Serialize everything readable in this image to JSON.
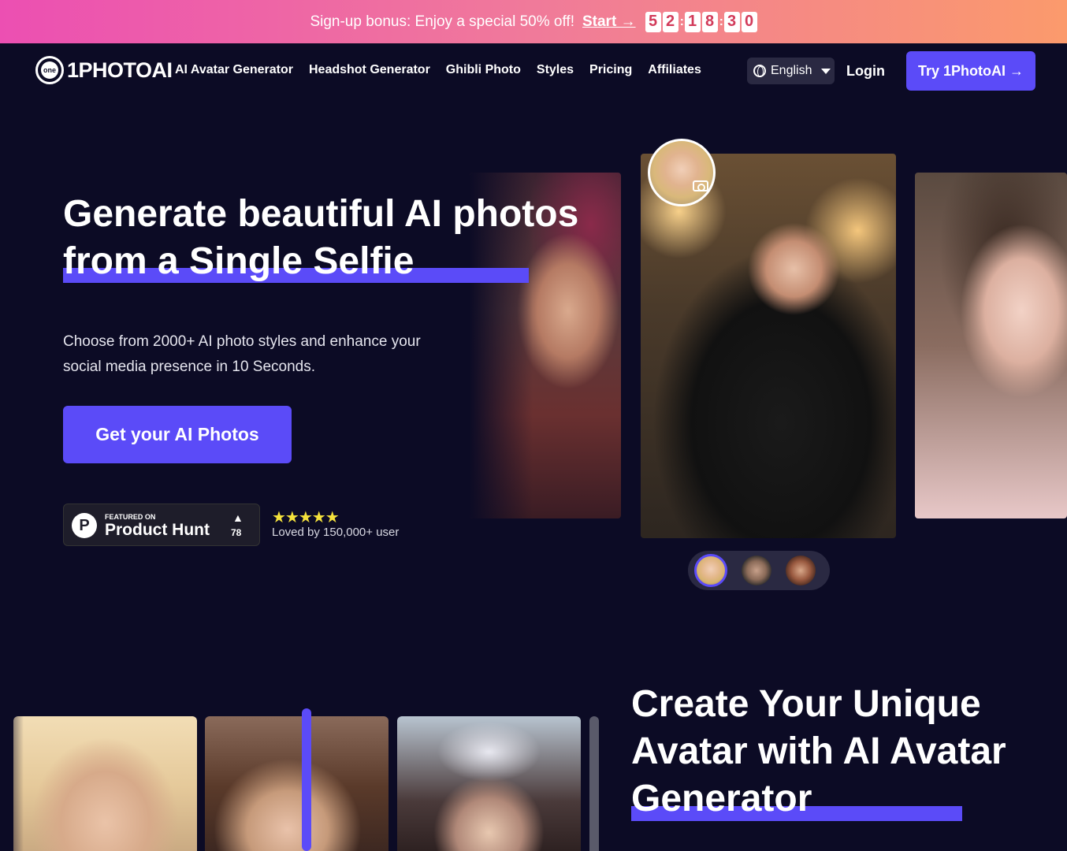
{
  "promo": {
    "text": "Sign-up bonus: Enjoy a special 50% off!",
    "link": "Start →",
    "timer_digits": [
      "5",
      "2",
      "1",
      "8",
      "3",
      "0"
    ]
  },
  "nav": {
    "logo_text": "1PHOTOAI",
    "logo_badge": "one",
    "links": [
      "AI Avatar Generator",
      "Headshot Generator",
      "Ghibli Photo",
      "Styles",
      "Pricing",
      "Affiliates"
    ],
    "language": "English",
    "login": "Login",
    "cta": "Try 1PhotoAI →"
  },
  "hero": {
    "title": "Generate beautiful AI photos from a Single Selfie",
    "subtitle": "Choose from 2000+ AI photo styles and enhance your social media presence in 10 Seconds.",
    "cta": "Get your AI Photos",
    "product_hunt": {
      "small": "FEATURED ON",
      "big": "Product Hunt",
      "count": "78",
      "logo": "P"
    },
    "rating_stars": "★★★★★",
    "loved_text": "Loved by 150,000+ user"
  },
  "section2": {
    "title": "Create Your Unique Avatar with AI Avatar Generator"
  },
  "colors": {
    "accent": "#5b4bf8",
    "background": "#0c0b25",
    "promo_start": "#ec4fb2",
    "promo_end": "#fb9a6c",
    "star": "#f5e23c"
  },
  "icons": [
    "globe-icon",
    "chevron-down-icon",
    "camera-icon",
    "arrow-up-icon"
  ]
}
